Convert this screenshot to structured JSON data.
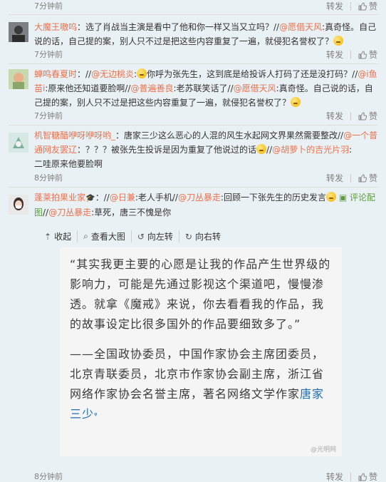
{
  "top_row": {
    "time": "7分钟前",
    "forward": "转发",
    "like": "赞"
  },
  "comments": [
    {
      "user": "大魔王嗷呜",
      "text1": "：选了肖战当主演是看中了他和你一样又当又立吗？//",
      "at1": "@愿借天风",
      "text2": ":真奇怪。自己说的话，自己提的案，别人只不过是把这些内容重复了一遍，就侵犯名誉权了？",
      "time": "7分钟前",
      "forward": "转发",
      "like": "赞"
    },
    {
      "user": "蝉鸣春夏时",
      "text1": "：//",
      "at1": "@无边桃炎",
      "text2": ":",
      "text3": "你呼为张先生，这到底是给投诉人打码了还是没打码？//",
      "at2": "@i鱼苗i",
      "text4": ":原来他还知道要脸啊//",
      "at3": "@普遍善良",
      "text5": ":老苏联笑话了//",
      "at4": "@愿借天风",
      "text6": ":真奇怪。自己说的话，自己提的案，别人只不过是把这些内容重复了一遍，就侵犯名誉权了？",
      "time": "7分钟前",
      "forward": "转发",
      "like": "赞"
    },
    {
      "user": "机智糖醋咿呀咿呀哟_",
      "text1": "：唐家三少这么恶心的人混的风生水起网文界果然需要整改//",
      "at1": "@一个普通网友罢辽",
      "text2": "：？？？被张先生投诉是因为重复了他说过的话",
      "at2": "@胡萝卜的吉光片羽",
      "text3": ":",
      "text4": "二哇原来他要脸啊",
      "time": "8分钟前",
      "forward": "转发",
      "like": "赞"
    },
    {
      "user": "蓬莱拍果业家",
      "text1": "：//",
      "at1": "@日兼",
      "text2": ":老人手机//",
      "at2": "@刀丛暴走",
      "text3": ":回顾一下张先生的历史发言",
      "pic_link": "评论配图",
      "text4": "//",
      "at3": "@刀丛暴走",
      "text5": ":草死，唐三不愧是你",
      "tools": [
        "收起",
        "查看大图",
        "向左转",
        "向右转"
      ],
      "time": "8分钟前",
      "forward": "转发",
      "like": "赞"
    }
  ],
  "image_text": {
    "p1": "“其实我更主要的心愿是让我的作品产生世界级的影响力，可能是先通过影视这个渠道吧，慢慢渗透。就拿《魔戒》来说，你去看看我的作品，我的故事设定比很多国外的作品要细致多了。”",
    "p2": "——全国政协委员，中国作家协会主席团委员，北京青联委员，北京市作家协会副主席，浙江省网络作家协会名誉主席，著名网络文学作家",
    "author": "唐家三少",
    "watermark": "@光明网"
  },
  "colors": {
    "username": "#eb7350",
    "link": "#eb7350",
    "author": "#1f6fb4"
  }
}
